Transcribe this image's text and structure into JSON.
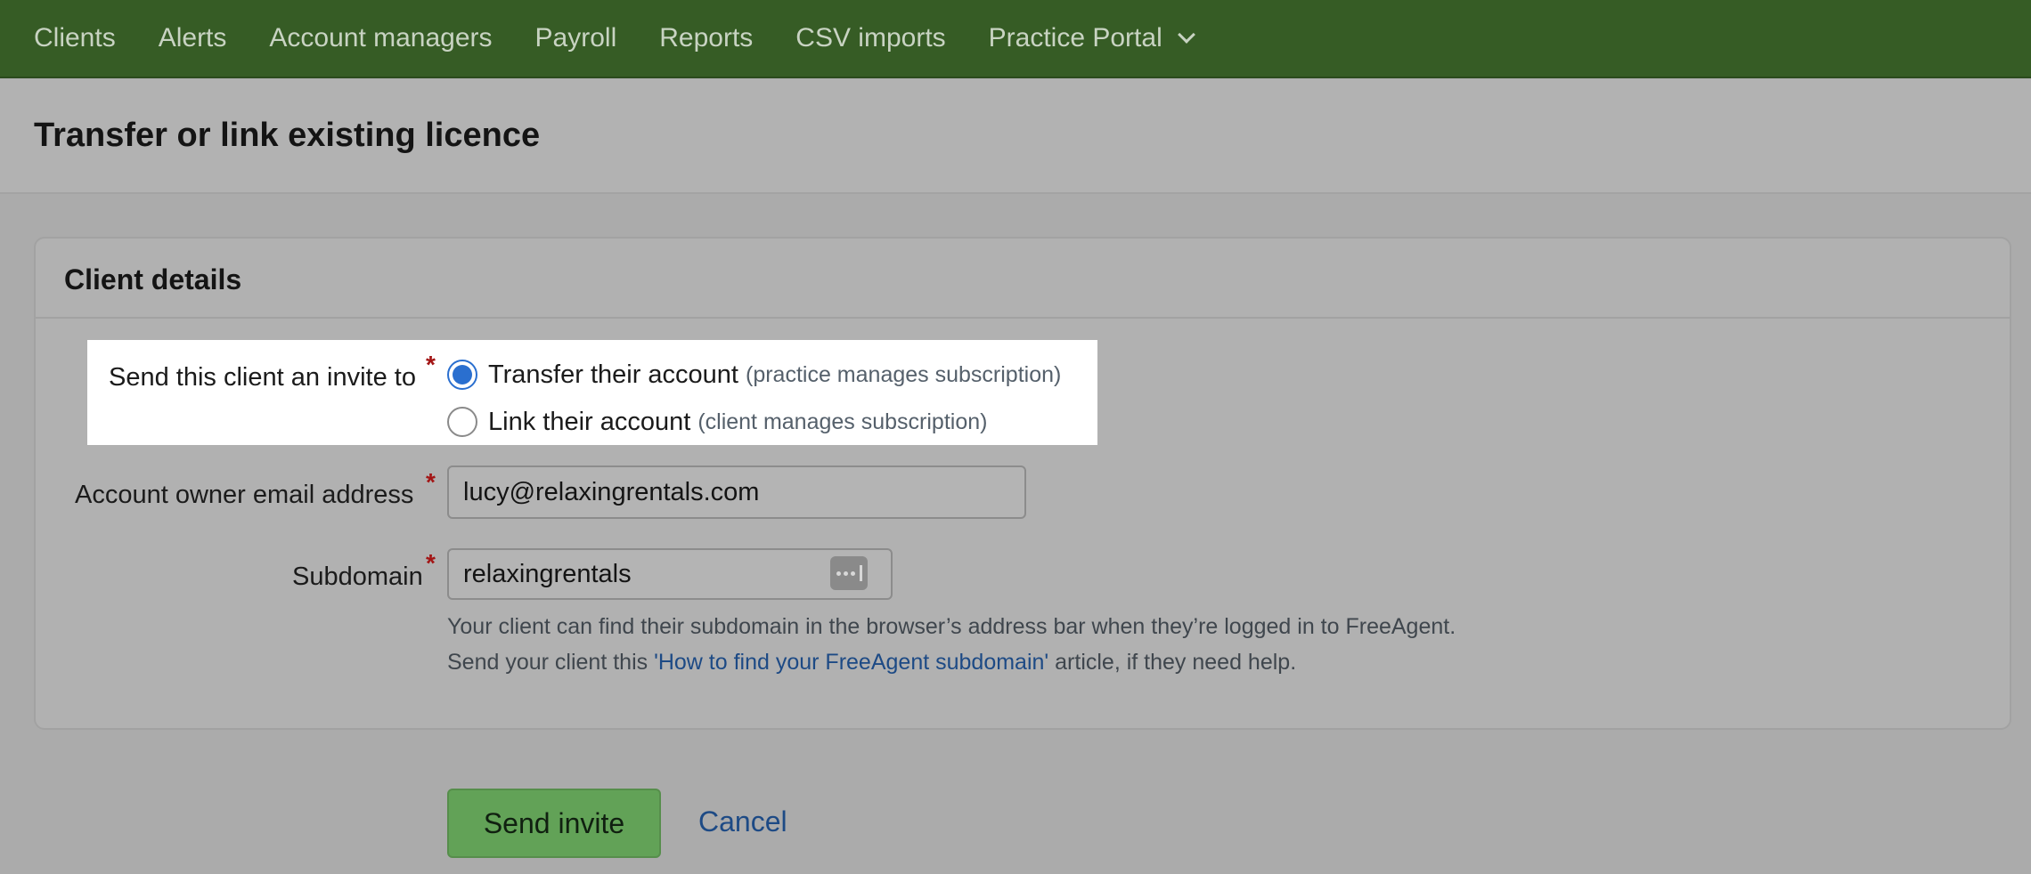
{
  "nav": {
    "items": [
      {
        "label": "Clients"
      },
      {
        "label": "Alerts"
      },
      {
        "label": "Account managers"
      },
      {
        "label": "Payroll"
      },
      {
        "label": "Reports"
      },
      {
        "label": "CSV imports"
      },
      {
        "label": "Practice Portal"
      }
    ]
  },
  "page": {
    "title": "Transfer or link existing licence"
  },
  "card": {
    "title": "Client details",
    "invite": {
      "label": "Send this client an invite to",
      "required_mark": "*",
      "options": [
        {
          "label": "Transfer their account",
          "hint": "(practice manages subscription)",
          "selected": true
        },
        {
          "label": "Link their account",
          "hint": "(client manages subscription)",
          "selected": false
        }
      ]
    },
    "email": {
      "label": "Account owner email address",
      "required_mark": "*",
      "value": "lucy@relaxingrentals.com"
    },
    "subdomain": {
      "label": "Subdomain",
      "required_mark": "*",
      "value": "relaxingrentals",
      "help_line1": "Your client can find their subdomain in the browser’s address bar when they’re logged in to FreeAgent.",
      "help_line2_prefix": "Send your client this ",
      "help_link": "'How to find your FreeAgent subdomain'",
      "help_line2_suffix": " article, if they need help."
    }
  },
  "actions": {
    "primary_label": "Send invite",
    "cancel_label": "Cancel"
  },
  "colors": {
    "nav_bg": "#365c25",
    "accent_blue": "#2a6fcf",
    "link": "#1d4a85",
    "button_green": "#62a257",
    "required": "#a31515"
  }
}
